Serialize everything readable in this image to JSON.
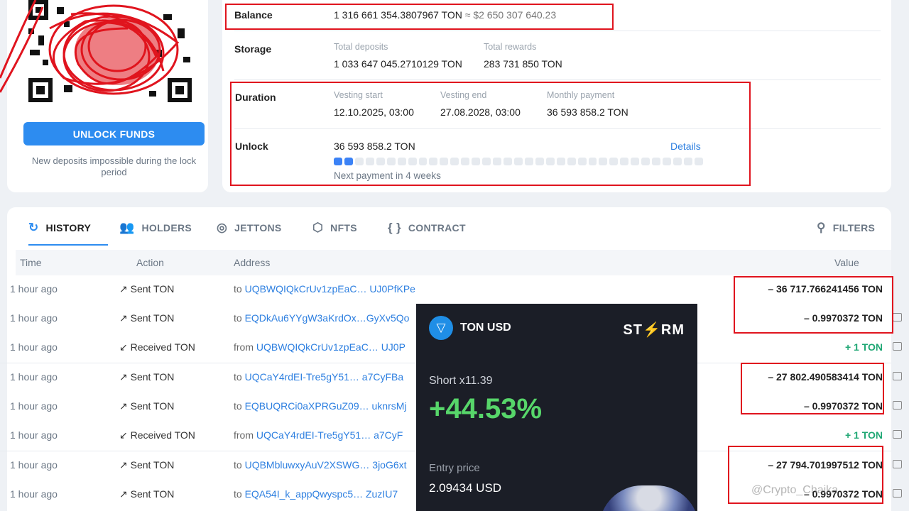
{
  "wallet": {
    "unlock_button": "UNLOCK FUNDS",
    "unlock_note": "New deposits impossible during the lock period"
  },
  "info": {
    "balance_label": "Balance",
    "balance_value": "1 316 661 354.3807967 TON",
    "balance_usd": "≈ $2 650 307 640.23",
    "storage_label": "Storage",
    "total_deposits_label": "Total deposits",
    "total_deposits_value": "1 033 647 045.2710129 TON",
    "total_rewards_label": "Total rewards",
    "total_rewards_value": "283 731 850 TON",
    "duration_label": "Duration",
    "vesting_start_label": "Vesting start",
    "vesting_start_value": "12.10.2025, 03:00",
    "vesting_end_label": "Vesting end",
    "vesting_end_value": "27.08.2028, 03:00",
    "monthly_payment_label": "Monthly payment",
    "monthly_payment_value": "36 593 858.2 TON",
    "unlock_label": "Unlock",
    "unlock_value": "36 593 858.2 TON",
    "details_link": "Details",
    "next_payment": "Next payment in 4 weeks",
    "unlock_progress": {
      "filled": 2,
      "total": 35
    }
  },
  "tabs": [
    {
      "label": "HISTORY",
      "icon": "history-icon"
    },
    {
      "label": "HOLDERS",
      "icon": "holders-icon"
    },
    {
      "label": "JETTONS",
      "icon": "jettons-icon"
    },
    {
      "label": "NFTS",
      "icon": "nfts-icon"
    },
    {
      "label": "CONTRACT",
      "icon": "contract-icon"
    }
  ],
  "filters_label": "FILTERS",
  "table": {
    "headers": {
      "time": "Time",
      "action": "Action",
      "address": "Address",
      "value": "Value"
    },
    "rows": [
      {
        "time": "1 hour ago",
        "action": "↗ Sent TON",
        "prefix": "to",
        "address": "UQBWQIQkCrUv1zpEaC… UJ0PfKPe",
        "value": "– 36 717.766241456 TON"
      },
      {
        "time": "1 hour ago",
        "action": "↗ Sent TON",
        "prefix": "to",
        "address": "EQDkAu6YYgW3aKrdOx…GyXv5Qo",
        "value": "– 0.9970372 TON"
      },
      {
        "time": "1 hour ago",
        "action": "↙ Received TON",
        "prefix": "from",
        "address": "UQBWQIQkCrUv1zpEaC… UJ0P",
        "value": "+ 1 TON"
      },
      {
        "time": "1 hour ago",
        "action": "↗ Sent TON",
        "prefix": "to",
        "address": "UQCaY4rdEI-Tre5gY51… a7CyFBa",
        "value": "– 27 802.490583414 TON"
      },
      {
        "time": "1 hour ago",
        "action": "↗ Sent TON",
        "prefix": "to",
        "address": "EQBUQRCi0aXPRGuZ09… uknrsMj",
        "value": "– 0.9970372 TON"
      },
      {
        "time": "1 hour ago",
        "action": "↙ Received TON",
        "prefix": "from",
        "address": "UQCaY4rdEI-Tre5gY51… a7CyF",
        "value": "+ 1 TON"
      },
      {
        "time": "1 hour ago",
        "action": "↗ Sent TON",
        "prefix": "to",
        "address": "UQBMbluwxyAuV2XSWG… 3joG6xt",
        "value": "– 27 794.701997512 TON"
      },
      {
        "time": "1 hour ago",
        "action": "↗ Sent TON",
        "prefix": "to",
        "address": "EQA54I_k_appQwyspc5… ZuzIU7",
        "value": "– 0.9970372 TON"
      }
    ]
  },
  "overlay": {
    "pair": "TON USD",
    "brand_a": "ST",
    "brand_b": "RM",
    "side": "Short x11.39",
    "pnl": "+44.53%",
    "entry_label": "Entry price",
    "entry_value": "2.09434 USD"
  },
  "watermark": "@Crypto_Chaika",
  "colors": {
    "accent": "#2d8cf0",
    "highlight": "#e0141e",
    "positive": "#1fa774",
    "pnl": "#57d66a"
  }
}
